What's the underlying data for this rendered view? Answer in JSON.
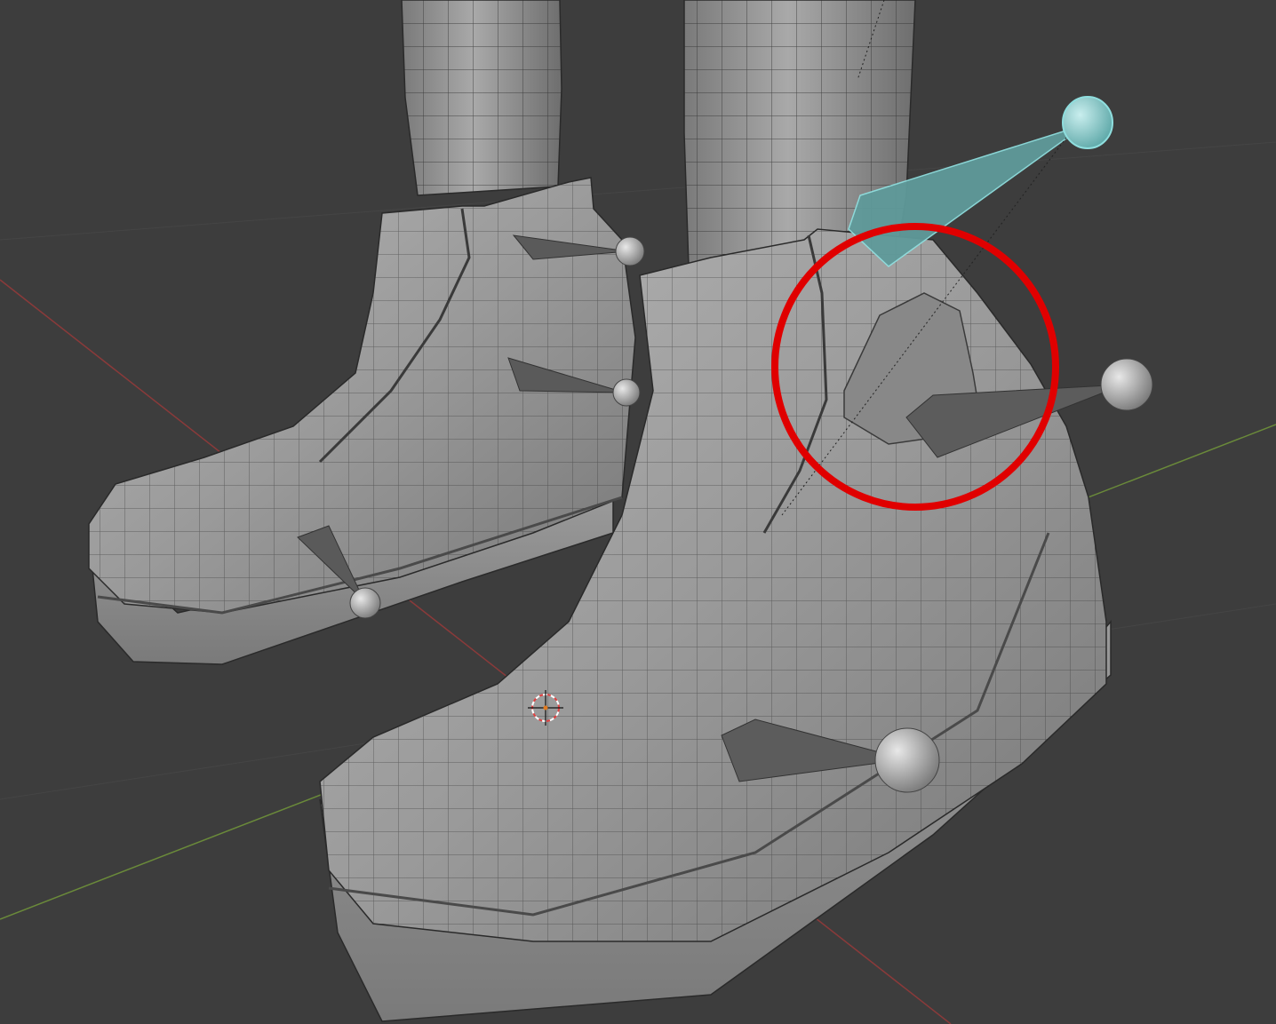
{
  "viewport": {
    "background": "#3d3d3d",
    "mesh_fill": "#8e8e8e",
    "mesh_wire": "#2a2a2a",
    "x_axis_color": "#8a3a3a",
    "y_axis_color": "#6a8a3a",
    "active_bone_color": "#7fc6c6",
    "annotation_color": "#e00000"
  },
  "scene": {
    "objects": [
      "left-leg",
      "right-leg",
      "left-boot",
      "right-boot"
    ],
    "bones": [
      "ankle-bone-left",
      "heel-bone-left",
      "toe-bone-left",
      "ankle-bone-right-active",
      "heel-bone-right",
      "toe-bone-right"
    ],
    "cursor": "3d-cursor-icon",
    "annotation": "red-circle-highlight"
  }
}
